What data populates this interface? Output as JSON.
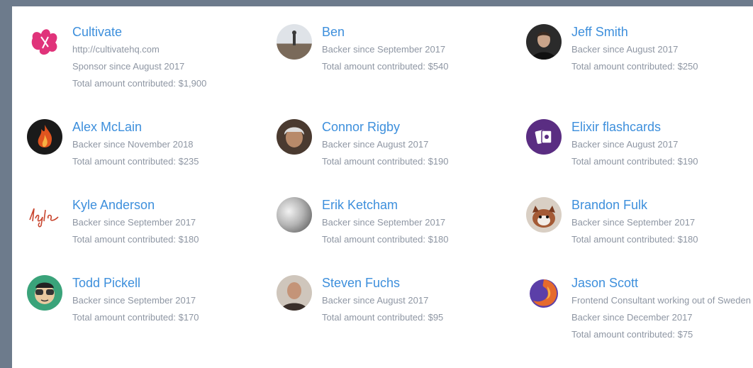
{
  "backers": [
    {
      "name": "Cultivate",
      "description": "http://cultivatehq.com",
      "since": "Sponsor since August 2017",
      "total": "Total amount contributed: $1,900",
      "avatar": "cultivate-logo-icon",
      "color": "#e0337a"
    },
    {
      "name": "Ben",
      "since": "Backer since September 2017",
      "total": "Total amount contributed: $540",
      "avatar": "person-photo-icon",
      "color": "#8a9bb0"
    },
    {
      "name": "Jeff Smith",
      "since": "Backer since August 2017",
      "total": "Total amount contributed: $250",
      "avatar": "person-photo-icon",
      "color": "#2b2b2b"
    },
    {
      "name": "Alex McLain",
      "since": "Backer since November 2018",
      "total": "Total amount contributed: $235",
      "avatar": "fire-icon",
      "color": "#1a1a1a"
    },
    {
      "name": "Connor Rigby",
      "since": "Backer since August 2017",
      "total": "Total amount contributed: $190",
      "avatar": "person-photo-icon",
      "color": "#6b5443"
    },
    {
      "name": "Elixir flashcards",
      "since": "Backer since August 2017",
      "total": "Total amount contributed: $190",
      "avatar": "flashcards-logo-icon",
      "color": "#5a2d82"
    },
    {
      "name": "Kyle Anderson",
      "since": "Backer since September 2017",
      "total": "Total amount contributed: $180",
      "avatar": "signature-logo-icon",
      "color": "#c8452e"
    },
    {
      "name": "Erik Ketcham",
      "since": "Backer since September 2017",
      "total": "Total amount contributed: $180",
      "avatar": "person-photo-icon",
      "color": "#9a9a9a"
    },
    {
      "name": "Brandon Fulk",
      "since": "Backer since September 2017",
      "total": "Total amount contributed: $180",
      "avatar": "red-panda-photo-icon",
      "color": "#a45a35"
    },
    {
      "name": "Todd Pickell",
      "since": "Backer since September 2017",
      "total": "Total amount contributed: $170",
      "avatar": "cartoon-face-icon",
      "color": "#3aa37a"
    },
    {
      "name": "Steven Fuchs",
      "since": "Backer since August 2017",
      "total": "Total amount contributed: $95",
      "avatar": "person-photo-icon",
      "color": "#7a5a4a"
    },
    {
      "name": "Jason Scott",
      "description": "Frontend Consultant working out of Sweden",
      "since": "Backer since December 2017",
      "total": "Total amount contributed: $75",
      "avatar": "firefox-logo-icon",
      "color": "#e56a2c"
    }
  ]
}
